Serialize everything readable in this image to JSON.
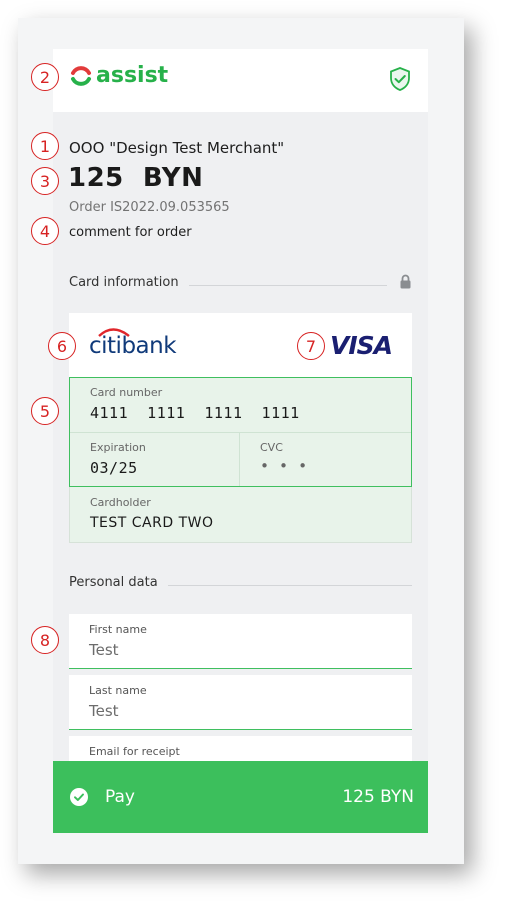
{
  "brand": {
    "logo_text": "assist"
  },
  "merchant": {
    "name": "OOO \"Design Test Merchant\""
  },
  "amount": {
    "display": "125  BYN"
  },
  "order": {
    "label": "Order IS2022.09.053565",
    "comment": "comment for order"
  },
  "card_section": {
    "title": "Card information",
    "bank_logo": "citibank",
    "network_logo": "VISA",
    "card_number_label": "Card number",
    "card_number_value": "4111  1111  1111  1111",
    "expiration_label": "Expiration",
    "expiration_value": "03/25",
    "cvc_label": "CVC",
    "cvc_value": "• • •",
    "cardholder_label": "Cardholder",
    "cardholder_value": "TEST CARD TWO"
  },
  "personal_section": {
    "title": "Personal data",
    "fields": [
      {
        "label": "First name",
        "value": "Test"
      },
      {
        "label": "Last name",
        "value": "Test"
      },
      {
        "label": "Email for receipt",
        "value": ""
      }
    ]
  },
  "pay_button": {
    "label": "Pay",
    "amount": "125 BYN"
  },
  "annotations": [
    "1",
    "2",
    "3",
    "4",
    "5",
    "6",
    "7",
    "8"
  ],
  "colors": {
    "brand_green": "#27b14a",
    "pay_green": "#3cbf5c",
    "field_border": "#3fbf5f",
    "annotation_red": "#d72323",
    "visa_blue": "#1a1f71",
    "citi_blue": "#103a7a"
  },
  "icons": [
    "assist-logo-icon",
    "shield-check-icon",
    "lock-icon",
    "check-circle-icon"
  ]
}
